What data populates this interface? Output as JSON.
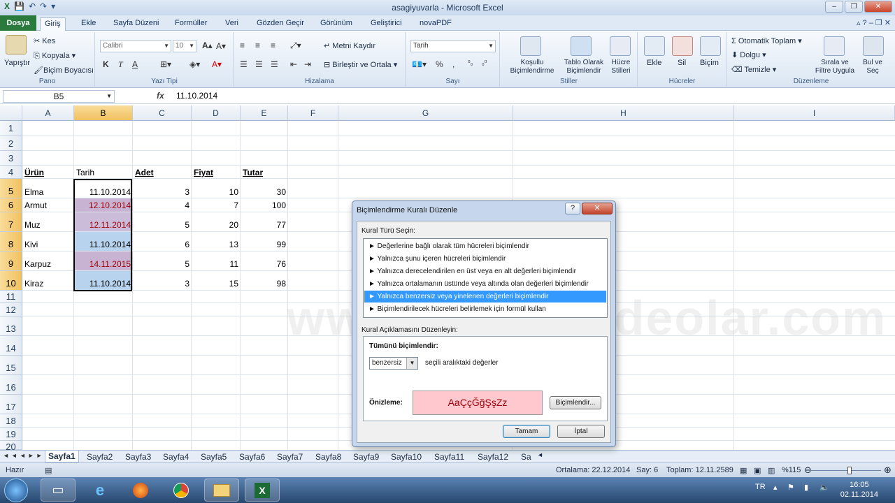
{
  "window": {
    "title": "asagiyuvarla  -  Microsoft Excel",
    "controls": [
      "–",
      "❐",
      "✕"
    ]
  },
  "ribbon_tabs": [
    "Dosya",
    "Giriş",
    "Ekle",
    "Sayfa Düzeni",
    "Formüller",
    "Veri",
    "Gözden Geçir",
    "Görünüm",
    "Geliştirici",
    "novaPDF"
  ],
  "ribbon": {
    "pano": {
      "label": "Pano",
      "paste": "Yapıştır",
      "cut": "Kes",
      "copy": "Kopyala",
      "format_painter": "Biçim Boyacısı"
    },
    "font": {
      "label": "Yazı Tipi",
      "font_name": "Calibri",
      "font_size": "10"
    },
    "alignment": {
      "label": "Hizalama",
      "wrap": "Metni Kaydır",
      "merge": "Birleştir ve Ortala"
    },
    "number": {
      "label": "Sayı",
      "format": "Tarih",
      "percent": "%"
    },
    "styles": {
      "label": "Stiller",
      "conditional": "Koşullu Biçimlendirme",
      "table": "Tablo Olarak Biçimlendir",
      "cell_styles": "Hücre Stilleri"
    },
    "cells": {
      "label": "Hücreler",
      "insert": "Ekle",
      "delete": "Sil",
      "format": "Biçim"
    },
    "editing": {
      "label": "Düzenleme",
      "autosum": "Otomatik Toplam",
      "fill": "Dolgu",
      "clear": "Temizle",
      "sort": "Sırala ve Filtre Uygula",
      "find": "Bul ve Seç"
    }
  },
  "formula_bar": {
    "name_box": "B5",
    "fx": "fx",
    "value": "11.10.2014"
  },
  "columns": [
    "A",
    "B",
    "C",
    "D",
    "E",
    "F",
    "G",
    "H",
    "I"
  ],
  "rows": [
    "1",
    "2",
    "3",
    "4",
    "5",
    "6",
    "7",
    "8",
    "9",
    "10",
    "11",
    "12",
    "13",
    "14",
    "15",
    "16",
    "17",
    "18",
    "19",
    "20"
  ],
  "table": {
    "headers": [
      "Ürün",
      "Tarih",
      "Adet",
      "Fiyat",
      "Tutar"
    ],
    "data": [
      [
        "Elma",
        "11.10.2014",
        "3",
        "10",
        "30"
      ],
      [
        "Armut",
        "12.10.2014",
        "4",
        "7",
        "100"
      ],
      [
        "Muz",
        "12.11.2014",
        "5",
        "20",
        "77"
      ],
      [
        "Kivi",
        "11.10.2014",
        "6",
        "13",
        "99"
      ],
      [
        "Karpuz",
        "14.11.2015",
        "5",
        "11",
        "76"
      ],
      [
        "Kiraz",
        "11.10.2014",
        "3",
        "15",
        "98"
      ]
    ]
  },
  "watermark": "www.eğitimvideolar.com",
  "sheets": [
    "Sayfa1",
    "Sayfa2",
    "Sayfa3",
    "Sayfa4",
    "Sayfa5",
    "Sayfa6",
    "Sayfa7",
    "Sayfa8",
    "Sayfa9",
    "Sayfa10",
    "Sayfa11",
    "Sayfa12",
    "Sa"
  ],
  "status": {
    "ready": "Hazır",
    "average": "Ortalama: 22.12.2014",
    "count": "Say: 6",
    "sum": "Toplam: 12.11.2589",
    "zoom": "%115"
  },
  "dialog": {
    "title": "Biçimlendirme Kuralı Düzenle",
    "help": "?",
    "close": "✕",
    "rule_type_label": "Kural Türü Seçin:",
    "rules": [
      "► Değerlerine bağlı olarak tüm hücreleri biçimlendir",
      "► Yalnızca şunu içeren hücreleri biçimlendir",
      "► Yalnızca derecelendirilen en üst veya en alt değerleri biçimlendir",
      "► Yalnızca ortalamanın üstünde veya altında olan değerleri biçimlendir",
      "► Yalnızca benzersiz veya yinelenen değerleri biçimlendir",
      "► Biçimlendirilecek hücreleri belirlemek için formül kullan"
    ],
    "selected_rule": 4,
    "desc_label": "Kural Açıklamasını Düzenleyin:",
    "format_all_label": "Tümünü biçimlendir:",
    "select_value": "benzersiz",
    "select_suffix": "seçili aralıktaki değerler",
    "preview_label": "Önizleme:",
    "preview_text": "AaÇçĞğŞşZz",
    "format_button": "Biçimlendir...",
    "ok": "Tamam",
    "cancel": "İptal"
  },
  "taskbar": {
    "lang": "TR",
    "time": "16:05",
    "date": "02.11.2014"
  },
  "colors": {
    "highlight_fill": "#c8b4d2",
    "highlight_text": "#9c0006",
    "preview_fill": "#ffc7ce",
    "selected_rule": "#3399ff"
  }
}
